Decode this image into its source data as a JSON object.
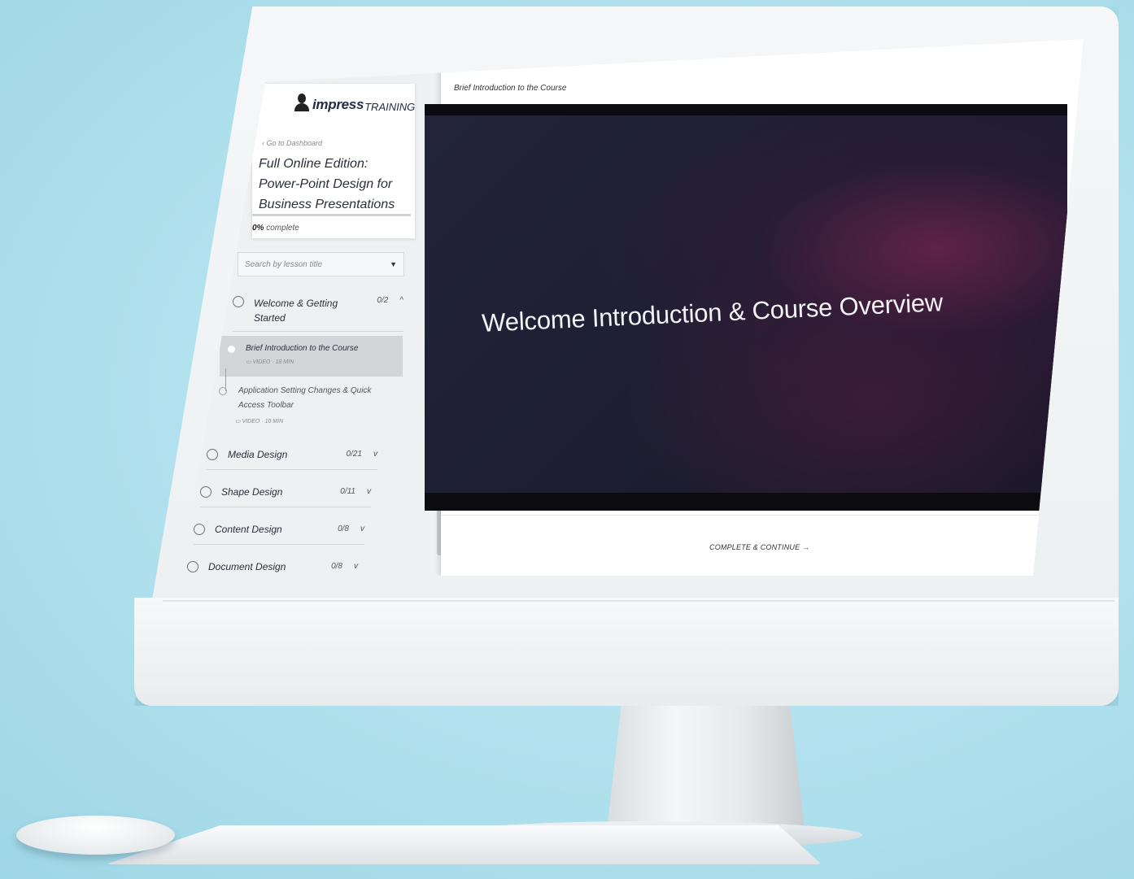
{
  "sidebar": {
    "logo": {
      "impress": "impress",
      "training": "TRAINING"
    },
    "back_link": "‹ Go to Dashboard",
    "course_title": "Full Online Edition: Power-Point Design for Business Presentations",
    "progress": {
      "percent_value": 0,
      "percent": "0%",
      "label": "complete"
    },
    "search_placeholder": "Search by lesson title",
    "sections": [
      {
        "title": "Welcome & Getting Started",
        "count": "0/2",
        "expanded": true,
        "lessons": [
          {
            "title": "Brief Introduction to the Course",
            "meta": "VIDEO · 18 MIN",
            "active": true
          },
          {
            "title": "Application Setting Changes & Quick Access Toolbar",
            "meta": "VIDEO · 10 MIN",
            "active": false
          }
        ]
      },
      {
        "title": "Media Design",
        "count": "0/21",
        "expanded": false
      },
      {
        "title": "Shape Design",
        "count": "0/11",
        "expanded": false
      },
      {
        "title": "Content Design",
        "count": "0/8",
        "expanded": false
      },
      {
        "title": "Document Design",
        "count": "0/8",
        "expanded": false
      }
    ]
  },
  "main": {
    "lesson_heading": "Brief Introduction to the Course",
    "video_title": "Welcome Introduction & Course Overview",
    "continue_label": "COMPLETE & CONTINUE →"
  },
  "icons": {
    "collapse": "chevron-up-icon",
    "expand": "chevron-down-icon",
    "dropdown": "caret-down-icon",
    "video": "video-icon"
  }
}
